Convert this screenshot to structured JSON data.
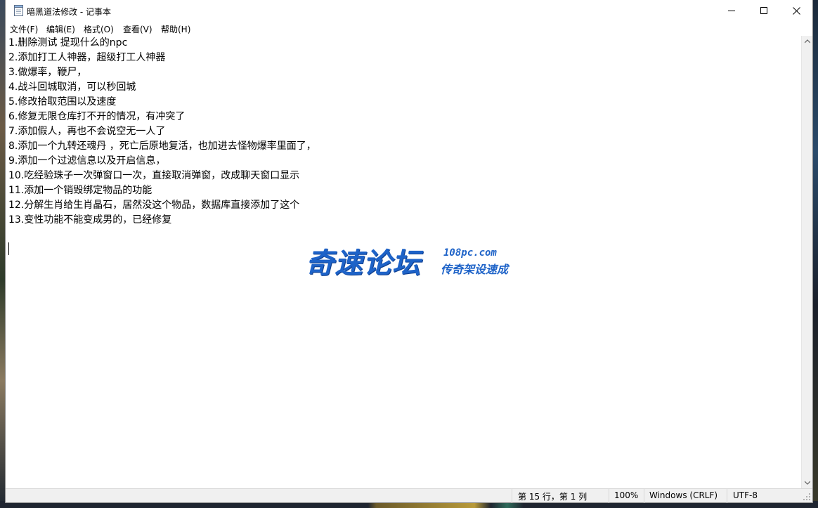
{
  "window": {
    "title": "暗黑道法修改 - 记事本",
    "controls": {
      "minimize": "minimize",
      "maximize": "maximize",
      "close": "close"
    }
  },
  "menu": [
    {
      "label": "文件(F)"
    },
    {
      "label": "编辑(E)"
    },
    {
      "label": "格式(O)"
    },
    {
      "label": "查看(V)"
    },
    {
      "label": "帮助(H)"
    }
  ],
  "editor": {
    "lines": [
      "1.删除测试 提现什么的npc",
      "2.添加打工人神器，超级打工人神器",
      "3.做爆率，鞭尸，",
      "4.战斗回城取消，可以秒回城",
      "5.修改拾取范围以及速度",
      "6.修复无限仓库打不开的情况，有冲突了",
      "7.添加假人，再也不会说空无一人了",
      "8.添加一个九转还魂丹 ，死亡后原地复活，也加进去怪物爆率里面了，",
      "9.添加一个过滤信息以及开启信息，",
      "10.吃经验珠子一次弹窗口一次，直接取消弹窗，改成聊天窗口显示",
      "11.添加一个销毁绑定物品的功能",
      "12.分解生肖给生肖晶石，居然没这个物品，数据库直接添加了这个",
      "13.变性功能不能变成男的，已经修复"
    ]
  },
  "watermark": {
    "main": "奇速论坛",
    "url": "108pc.com",
    "sub": "传奇架设速成"
  },
  "status": {
    "position": "第 15 行，第 1 列",
    "zoom": "100%",
    "line_ending": "Windows (CRLF)",
    "encoding": "UTF-8"
  },
  "colors": {
    "watermark_blue": "#1e63c8"
  }
}
